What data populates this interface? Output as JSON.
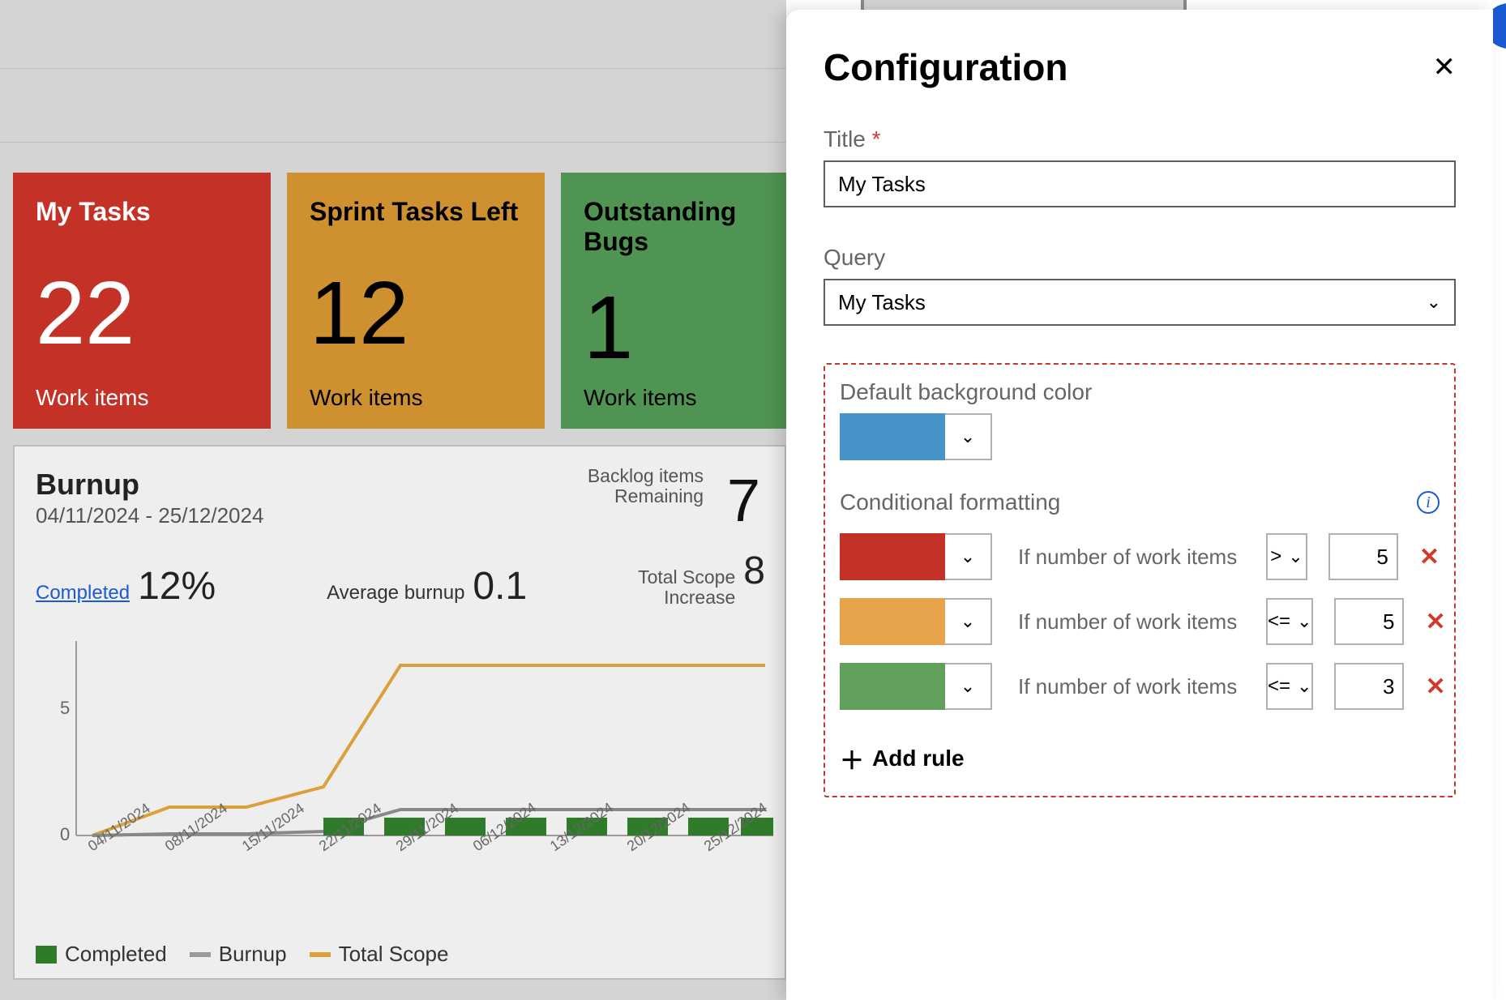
{
  "tiles": [
    {
      "title": "My Tasks",
      "value": "22",
      "sub": "Work items"
    },
    {
      "title": "Sprint Tasks Left",
      "value": "12",
      "sub": "Work items"
    },
    {
      "title": "Outstanding Bugs",
      "value": "1",
      "sub": "Work items"
    }
  ],
  "burnup": {
    "title": "Burnup",
    "date_range": "04/11/2024 - 25/12/2024",
    "completed_label": "Completed",
    "completed_value": "12%",
    "avg_label": "Average burnup",
    "avg_value": "0.1",
    "backlog_label": "Backlog items",
    "remaining_label": "Remaining",
    "backlog_value": "7",
    "scope_label_1": "Total Scope",
    "scope_label_2": "Increase",
    "scope_value": "8",
    "legend": {
      "completed": "Completed",
      "burnup": "Burnup",
      "total_scope": "Total Scope"
    }
  },
  "chart_data": {
    "type": "line",
    "xlabel": "",
    "ylabel": "",
    "ylim": [
      0,
      8
    ],
    "y_ticks": [
      0,
      5
    ],
    "categories": [
      "04/11/2024",
      "08/11/2024",
      "15/11/2024",
      "22/11/2024",
      "29/11/2024",
      "06/12/2024",
      "13/12/2024",
      "20/12/2024",
      "25/12/2024"
    ],
    "series": [
      {
        "name": "Total Scope",
        "values": [
          0,
          1,
          1,
          2,
          7,
          7,
          7,
          7,
          7
        ]
      },
      {
        "name": "Burnup",
        "values": [
          0,
          0,
          0,
          0,
          1,
          1,
          1,
          1,
          1
        ]
      }
    ],
    "bars": {
      "name": "Completed",
      "values": [
        0,
        0,
        0,
        0,
        1,
        1,
        1,
        1,
        1
      ]
    }
  },
  "panel": {
    "title": "Configuration",
    "title_field": {
      "label": "Title",
      "value": "My Tasks"
    },
    "query_field": {
      "label": "Query",
      "value": "My Tasks"
    },
    "default_bg_label": "Default background color",
    "default_bg_color": "#4593c9",
    "cond_label": "Conditional formatting",
    "cond_text": "If number of work items",
    "rules": [
      {
        "color": "#c33127",
        "op": ">",
        "value": "5"
      },
      {
        "color": "#e6a34a",
        "op": "<=",
        "value": "5"
      },
      {
        "color": "#60a05a",
        "op": "<=",
        "value": "3"
      }
    ],
    "add_rule_label": "Add rule"
  }
}
